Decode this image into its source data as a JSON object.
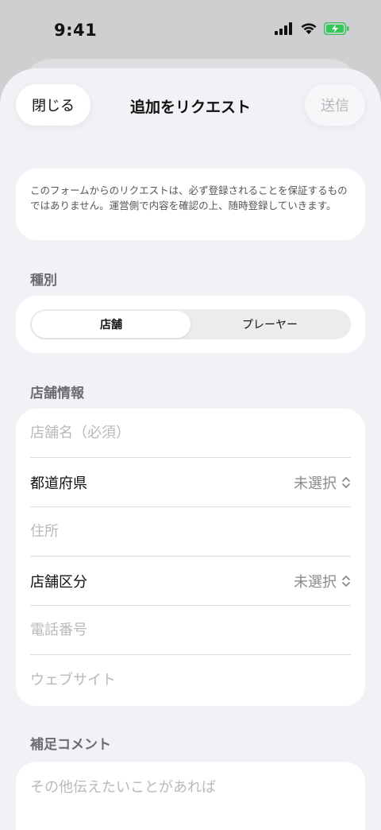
{
  "status_bar": {
    "time": "9:41"
  },
  "nav": {
    "close_label": "閉じる",
    "title": "追加をリクエスト",
    "send_label": "送信"
  },
  "notice": {
    "text": "このフォームからのリクエストは、必ず登録されることを保証するものではありません。運営側で内容を確認の上、随時登録していきます。"
  },
  "type_section": {
    "label": "種別",
    "options": [
      "店舗",
      "プレーヤー"
    ],
    "selected": "店舗"
  },
  "store_section": {
    "label": "店舗情報",
    "name_placeholder": "店舗名（必須）",
    "prefecture_label": "都道府県",
    "prefecture_value": "未選択",
    "address_placeholder": "住所",
    "category_label": "店舗区分",
    "category_value": "未選択",
    "phone_placeholder": "電話番号",
    "website_placeholder": "ウェブサイト"
  },
  "comment_section": {
    "label": "補足コメント",
    "placeholder": "その他伝えたいことがあれば"
  },
  "colors": {
    "background": "#f2f2f6",
    "card": "#ffffff",
    "placeholder": "#b9b9be",
    "battery": "#34c759"
  }
}
